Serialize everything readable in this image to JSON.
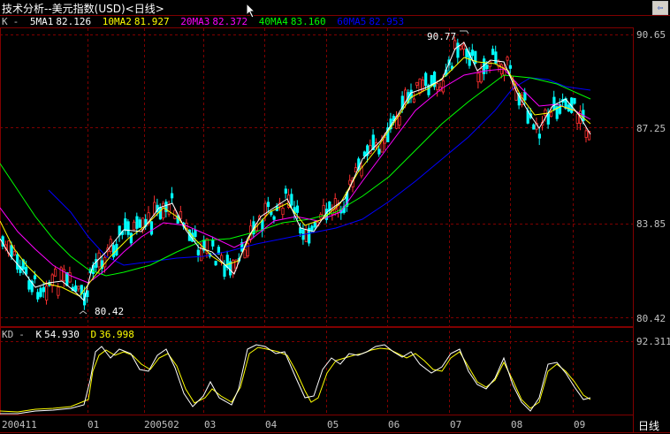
{
  "window": {
    "title": "技术分析--美元指数(USD)<日线>",
    "nav_icon": "back-arrow-icon"
  },
  "legend": {
    "indicator": "K",
    "sep": "-",
    "items": [
      {
        "name": "5MA1",
        "value": "82.126",
        "color": "#ffffff"
      },
      {
        "name": "10MA2",
        "value": "81.927",
        "color": "#ffff00"
      },
      {
        "name": "20MA3",
        "value": "82.372",
        "color": "#ff00ff"
      },
      {
        "name": "40MA4",
        "value": "83.160",
        "color": "#00ff00"
      },
      {
        "name": "60MA5",
        "value": "82.953",
        "color": "#0000ff"
      }
    ]
  },
  "kd_legend": {
    "indicator": "KD",
    "sep": "-",
    "k_label": "K",
    "k_value": "54.930",
    "d_label": "D",
    "d_value": "36.998"
  },
  "price_axis": [
    "90.65",
    "87.25",
    "83.85",
    "80.42"
  ],
  "kd_axis": [
    "92.311"
  ],
  "annotations": {
    "high": "90.77",
    "low": "80.42"
  },
  "x_labels": [
    "200411",
    "01",
    "200502",
    "03",
    "04",
    "05",
    "06",
    "07",
    "08",
    "09"
  ],
  "period_label": "日线",
  "colors": {
    "grid": "#800000",
    "up": "#ff3030",
    "down": "#00ffff",
    "k": "#ffffff",
    "d": "#ffff00"
  }
}
